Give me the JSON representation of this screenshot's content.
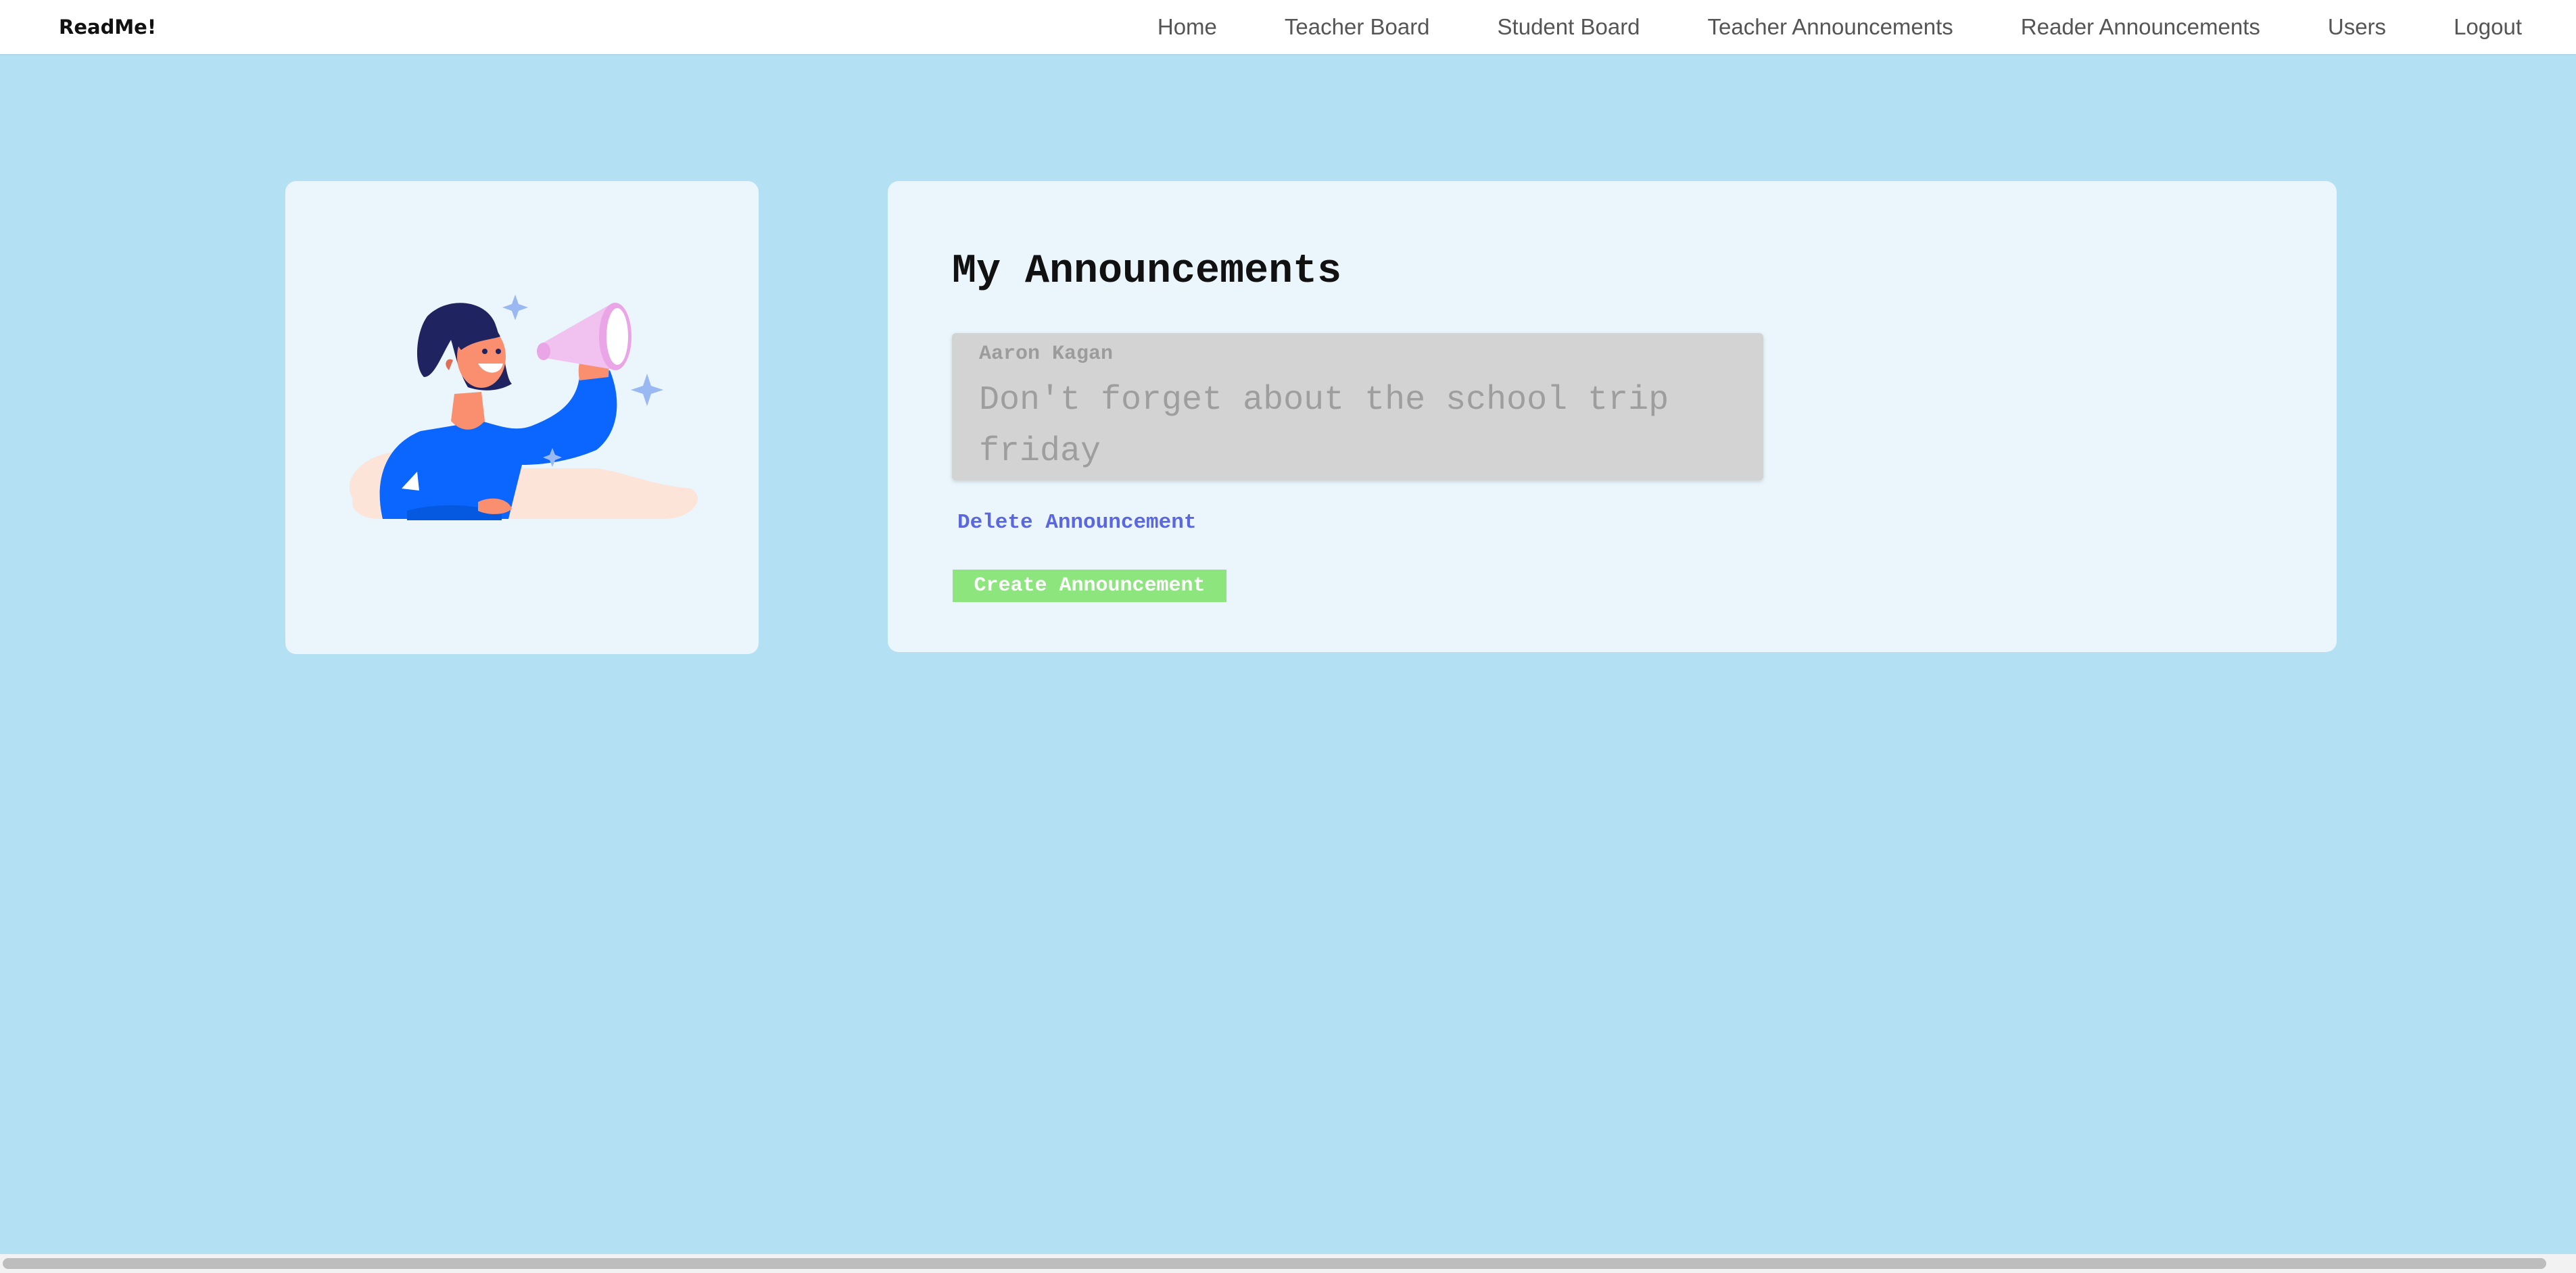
{
  "navbar": {
    "brand": "ReadMe!",
    "links": [
      "Home",
      "Teacher Board",
      "Student Board",
      "Teacher Announcements",
      "Reader Announcements",
      "Users",
      "Logout"
    ]
  },
  "illustration": {
    "icon": "woman-with-megaphone-illustration"
  },
  "main": {
    "title": "My Announcements",
    "announcements": [
      {
        "author": "Aaron Kagan",
        "text": "Don't forget about the school trip friday"
      }
    ],
    "delete_label": "Delete Announcement",
    "create_label": "Create Announcement"
  },
  "colors": {
    "page_background": "#b4e0f3",
    "card_background": "#eaf5fc",
    "announcement_background": "#d3d3d3",
    "delete_link": "#5a67e0",
    "create_button": "#8ce57d"
  }
}
